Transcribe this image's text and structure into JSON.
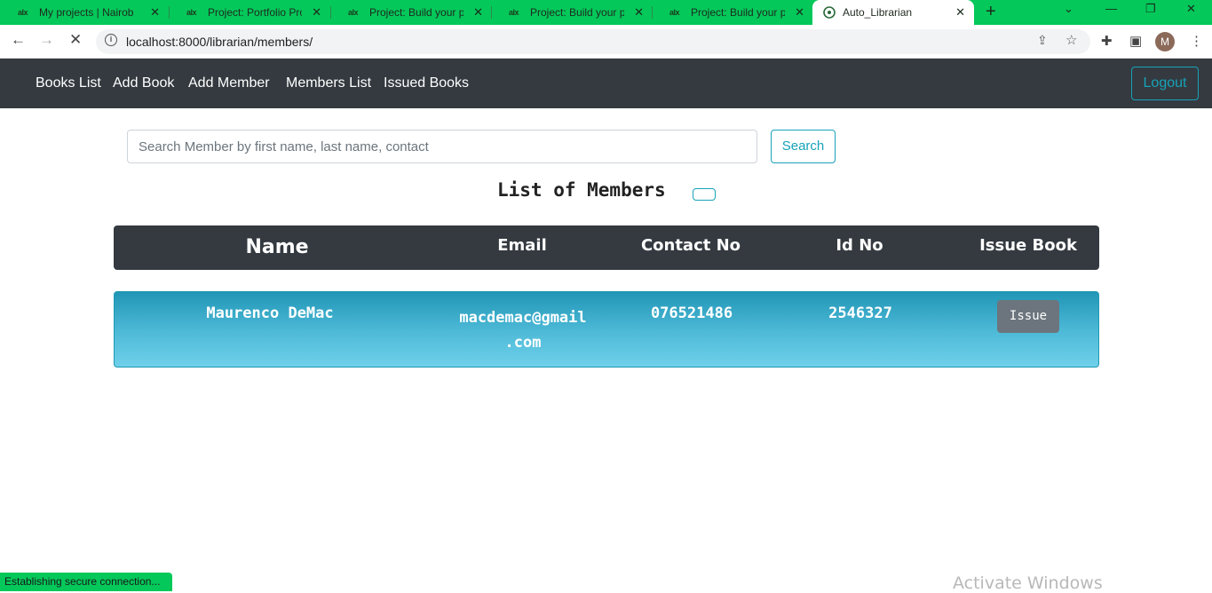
{
  "browser": {
    "tabs": [
      {
        "favicon": "alx",
        "title": "My projects | Nairobi"
      },
      {
        "favicon": "alx",
        "title": "Project: Portfolio Proje"
      },
      {
        "favicon": "alx",
        "title": "Project: Build your por"
      },
      {
        "favicon": "alx",
        "title": "Project: Build your por"
      },
      {
        "favicon": "alx",
        "title": "Project: Build your por"
      },
      {
        "favicon": "globe-icon",
        "title": "Auto_Librarian"
      }
    ],
    "url": "localhost:8000/librarian/members/",
    "profile_initial": "M",
    "status_text": "Establishing secure connection..."
  },
  "navbar": {
    "links": [
      "Books List",
      "Add Book",
      "Add Member",
      "Members List",
      "Issued Books"
    ],
    "logout_label": "Logout"
  },
  "search": {
    "placeholder": "Search Member by first name, last name, contact",
    "button_label": "Search"
  },
  "list_title": "List of Members",
  "table": {
    "headers": {
      "name": "Name",
      "email": "Email",
      "contact": "Contact No",
      "id": "Id No",
      "issue": "Issue Book"
    },
    "rows": [
      {
        "name": "Maurenco DeMac",
        "email_line1": "macdemac@gmail",
        "email_line2": ".com",
        "contact": "076521486",
        "id": "2546327",
        "action": "Issue"
      }
    ]
  },
  "watermark": "Activate Windows",
  "colors": {
    "tab_strip": "#04c85a",
    "navbar": "#343a40",
    "accent": "#17a2b8",
    "row": "#4fbbd8"
  }
}
